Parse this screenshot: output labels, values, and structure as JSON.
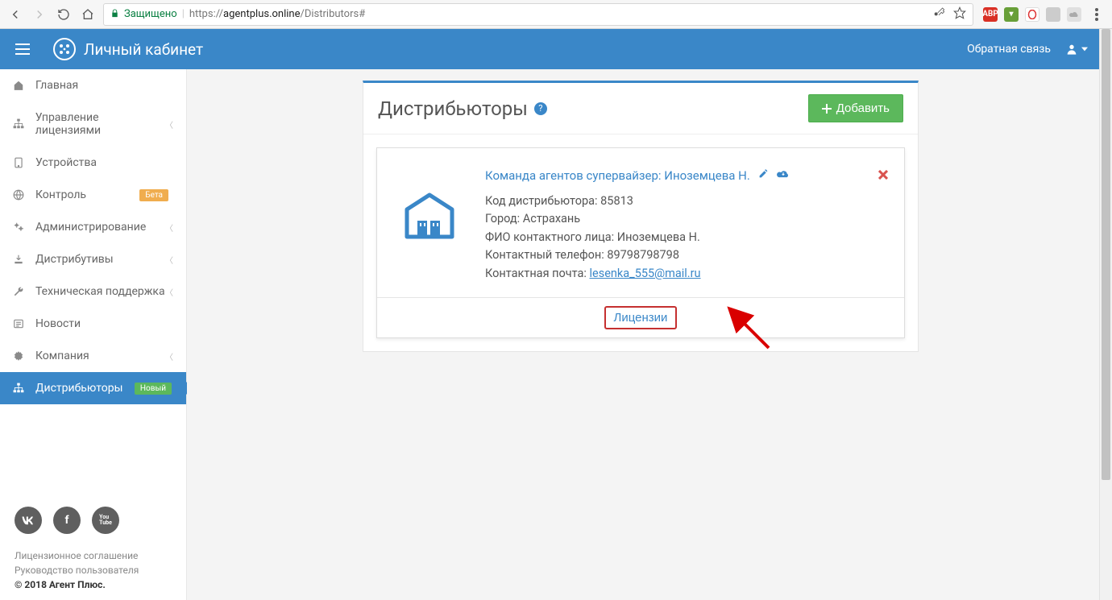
{
  "browser": {
    "secure_label": "Защищено",
    "url_prefix": "https://",
    "url_host": "agentplus.online",
    "url_path": "/Distributors#"
  },
  "header": {
    "brand": "Личный кабинет",
    "feedback": "Обратная связь"
  },
  "sidebar": {
    "items": [
      {
        "icon": "home",
        "label": "Главная",
        "chev": false
      },
      {
        "icon": "sitemap",
        "label": "Управление лицензиями",
        "chev": true
      },
      {
        "icon": "tablet",
        "label": "Устройства",
        "chev": false
      },
      {
        "icon": "globe",
        "label": "Контроль",
        "chev": false,
        "badge": "Бета",
        "badge_kind": "badge-beta"
      },
      {
        "icon": "cogs",
        "label": "Администрирование",
        "chev": true
      },
      {
        "icon": "download",
        "label": "Дистрибутивы",
        "chev": true
      },
      {
        "icon": "wrench",
        "label": "Техническая поддержка",
        "chev": true
      },
      {
        "icon": "news",
        "label": "Новости",
        "chev": false
      },
      {
        "icon": "gear",
        "label": "Компания",
        "chev": true
      },
      {
        "icon": "sitemap",
        "label": "Дистрибьюторы",
        "chev": false,
        "badge": "Новый",
        "badge_kind": "badge-new",
        "active": true
      }
    ],
    "footer": {
      "license": "Лицензионное соглашение",
      "guide": "Руководство пользователя",
      "copyright": "© 2018 Агент Плюс."
    }
  },
  "page": {
    "title": "Дистрибьюторы",
    "add_btn": "Добавить"
  },
  "distributor": {
    "title": "Команда агентов супервайзер: Иноземцева Н.",
    "code_label": "Код дистрибьютора:",
    "code_value": "85813",
    "city_label": "Город:",
    "city_value": "Астрахань",
    "contact_name_label": "ФИО контактного лица:",
    "contact_name_value": "Иноземцева Н.",
    "phone_label": "Контактный телефон:",
    "phone_value": "89798798798",
    "email_label": "Контактная почта:",
    "email_value": "lesenka_555@mail.ru",
    "licenses_btn": "Лицензии"
  }
}
